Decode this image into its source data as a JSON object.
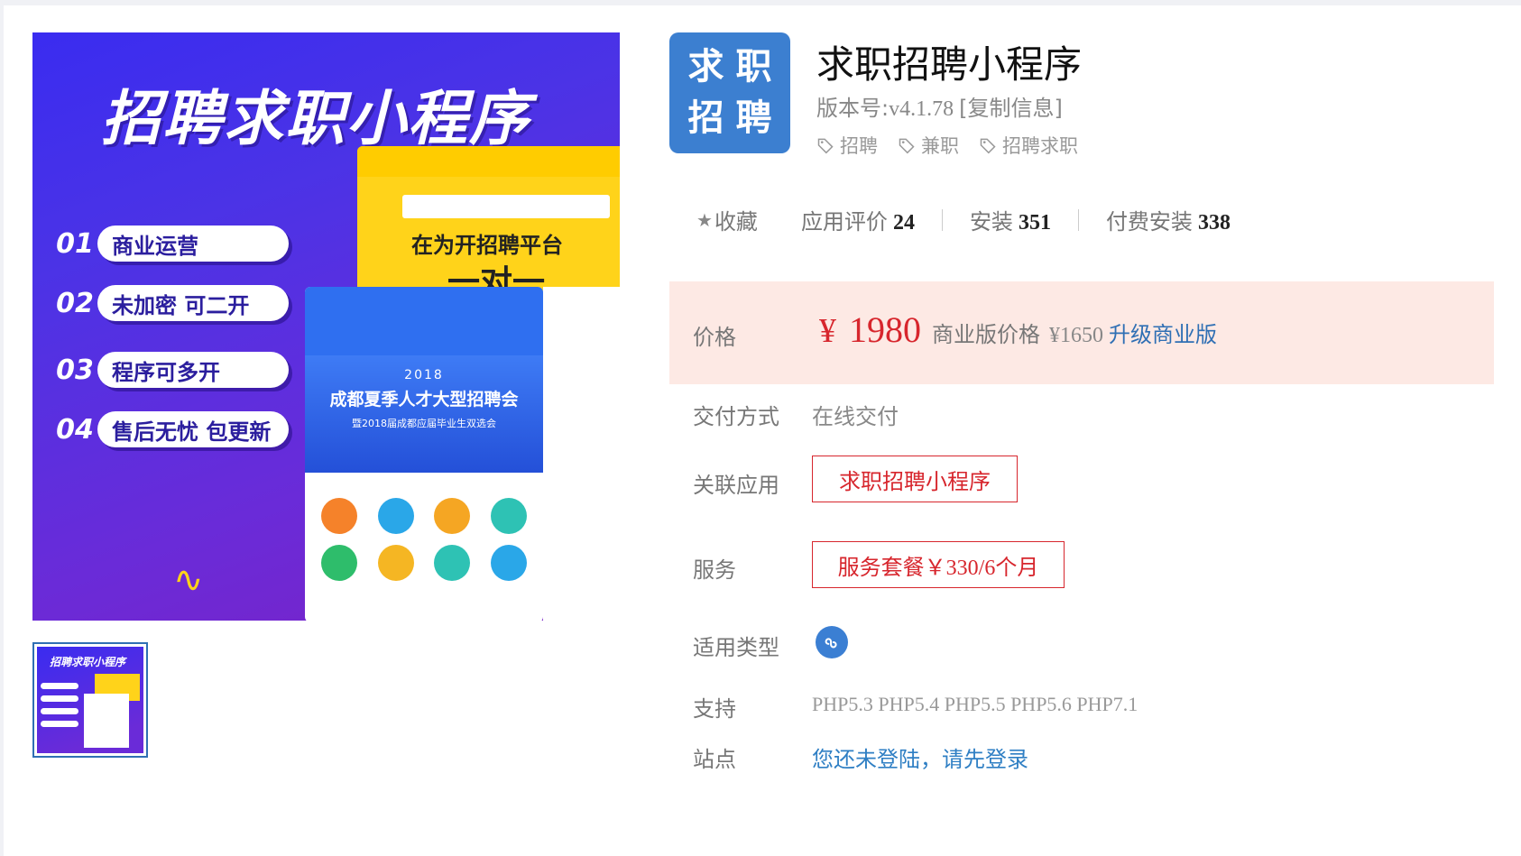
{
  "product": {
    "title": "求职招聘小程序",
    "logo_chars": [
      "求",
      "职",
      "招",
      "聘"
    ],
    "version_label": "版本号:",
    "version": "v4.1.78",
    "copy_info": "[复制信息]",
    "tags": [
      "招聘",
      "兼职",
      "招聘求职"
    ]
  },
  "gallery": {
    "hero_title": "招聘求职小程序",
    "features": [
      {
        "num": "01",
        "text": "商业运营"
      },
      {
        "num": "02",
        "text": "未加密 可二开"
      },
      {
        "num": "03",
        "text": "程序可多开"
      },
      {
        "num": "04",
        "text": "售后无忧 包更新"
      }
    ],
    "yellow_slogan": "在为开招聘平台",
    "yellow_big": "一对一",
    "banner_year": "2018",
    "banner_title": "成都夏季人才大型招聘会",
    "banner_sub": "暨2018届成都应届毕业生双选会",
    "thumb_title": "招聘求职小程序"
  },
  "stats": {
    "favorite": "收藏",
    "rating_label": "应用评价",
    "rating": "24",
    "install_label": "安装",
    "install": "351",
    "paid_install_label": "付费安装",
    "paid_install": "338"
  },
  "price": {
    "label": "价格",
    "currency": "¥",
    "amount": "1980",
    "biz_label": "商业版价格",
    "biz_amount": "¥1650",
    "upgrade": "升级商业版"
  },
  "details": {
    "delivery_label": "交付方式",
    "delivery": "在线交付",
    "related_label": "关联应用",
    "related": "求职招聘小程序",
    "service_label": "服务",
    "service": "服务套餐￥330/6个月",
    "type_label": "适用类型",
    "support_label": "支持",
    "support": "PHP5.3 PHP5.4 PHP5.5 PHP5.6 PHP7.1",
    "site_label": "站点",
    "site": "您还未登陆，请先登录"
  },
  "colors": {
    "accent_red": "#d7262d",
    "link_blue": "#2f7fc4",
    "logo_blue": "#3c7fd0",
    "price_bg": "#fde9e4"
  }
}
